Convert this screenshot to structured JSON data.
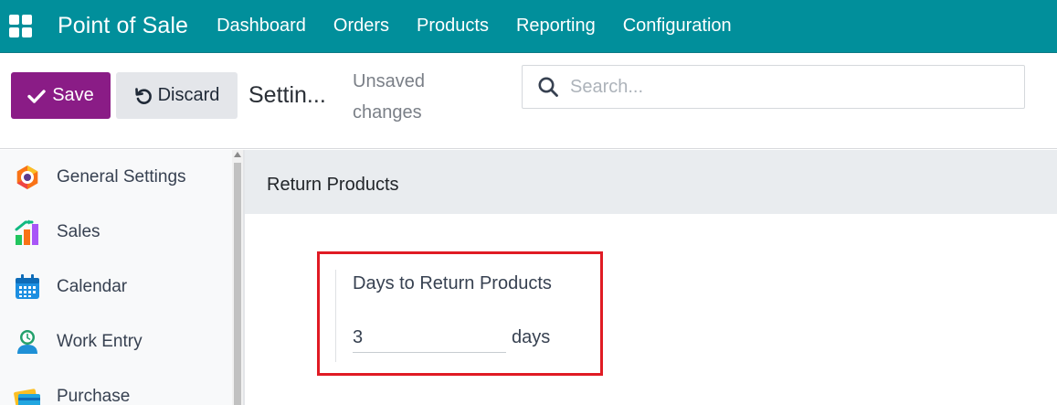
{
  "navbar": {
    "brand": "Point of Sale",
    "menu": [
      "Dashboard",
      "Orders",
      "Products",
      "Reporting",
      "Configuration"
    ],
    "background": "#018f9b"
  },
  "control_panel": {
    "save_label": "Save",
    "discard_label": "Discard",
    "title": "Settin...",
    "unsaved_text": "Unsaved changes",
    "search_placeholder": "Search...",
    "save_color": "#8a1c86"
  },
  "sidebar": {
    "items": [
      {
        "label": "General Settings",
        "icon": "general-settings-icon"
      },
      {
        "label": "Sales",
        "icon": "sales-icon"
      },
      {
        "label": "Calendar",
        "icon": "calendar-icon"
      },
      {
        "label": "Work Entry",
        "icon": "work-entry-icon"
      },
      {
        "label": "Purchase",
        "icon": "purchase-icon"
      }
    ]
  },
  "main": {
    "section_title": "Return Products",
    "setting": {
      "label": "Days to Return Products",
      "value": "3",
      "unit": "days"
    },
    "highlight_color": "#e01b24"
  }
}
